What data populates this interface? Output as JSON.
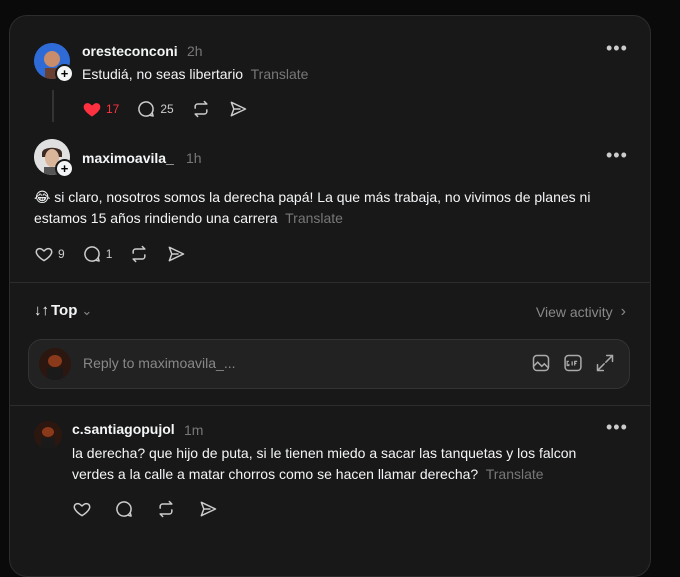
{
  "comments": [
    {
      "username": "oresteconconi",
      "time": "2h",
      "text": "Estudiá, no seas libertario",
      "translate": "Translate",
      "likes": "17",
      "replies": "25",
      "liked": true
    },
    {
      "username": "maximoavila_",
      "time": "1h",
      "emoji": "😂",
      "text_line1": "si claro, nosotros somos la derecha papá! La que más trabaja, no vivimos de planes ni",
      "text_line2": "estamos 15 años rindiendo una carrera",
      "translate": "Translate",
      "likes": "9",
      "replies": "1"
    }
  ],
  "sort": {
    "label": "Top",
    "arrows": "↓↑",
    "chevron": "⌄"
  },
  "view_activity": {
    "label": "View activity",
    "chevron": "›"
  },
  "reply_box": {
    "placeholder": "Reply to maximoavila_..."
  },
  "reply": {
    "username": "c.santiagopujol",
    "time": "1m",
    "text_line1": "la derecha? que hijo de puta, si le tienen miedo a sacar las tanquetas y los falcon",
    "text_line2": "verdes a la calle a matar chorros como se hacen llamar derecha?",
    "translate": "Translate"
  },
  "more_glyph": "•••",
  "plus_glyph": "+",
  "icons": [
    "heart-icon",
    "comment-icon",
    "repost-icon",
    "share-icon",
    "image-icon",
    "gif-icon",
    "expand-icon",
    "more-icon"
  ],
  "colors": {
    "background": "#181818",
    "liked_red": "#ff3040",
    "muted": "#777777"
  }
}
